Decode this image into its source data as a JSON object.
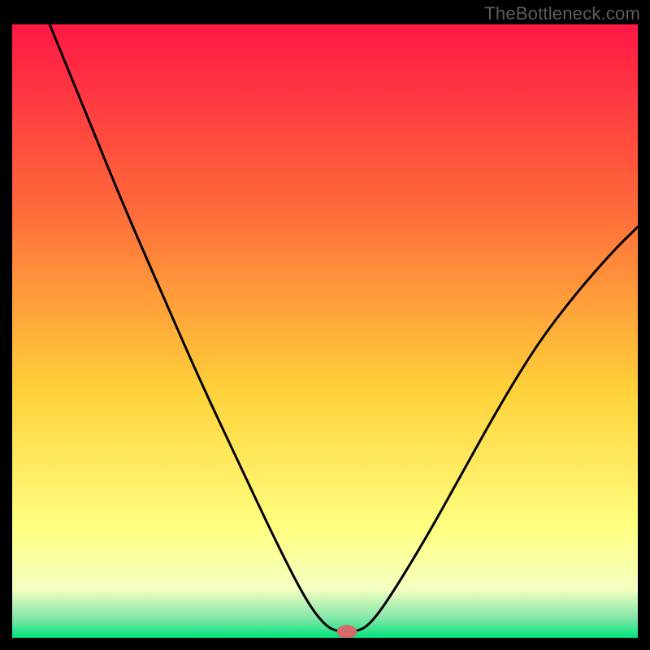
{
  "watermark": "TheBottleneck.com",
  "chart_data": {
    "type": "line",
    "title": "",
    "xlabel": "",
    "ylabel": "",
    "xlim": [
      0,
      100
    ],
    "ylim": [
      0,
      100
    ],
    "grid": false,
    "legend": false,
    "background_gradient": {
      "top_color": "#ff1845",
      "mid_top_color": "#ff6a3a",
      "mid_color": "#ffd23a",
      "mid_low_color": "#ffff80",
      "low_band_color": "#f5ffc0",
      "bottom_band_color": "#7de6a9",
      "bottom_color": "#00e47a"
    },
    "series": [
      {
        "name": "bottleneck-curve",
        "color": "#000000",
        "points": [
          {
            "x": 6,
            "y": 100
          },
          {
            "x": 12,
            "y": 85
          },
          {
            "x": 18,
            "y": 70
          },
          {
            "x": 24,
            "y": 56
          },
          {
            "x": 30,
            "y": 42
          },
          {
            "x": 36,
            "y": 29
          },
          {
            "x": 42,
            "y": 16
          },
          {
            "x": 47,
            "y": 6
          },
          {
            "x": 50,
            "y": 2
          },
          {
            "x": 52,
            "y": 1
          },
          {
            "x": 55,
            "y": 1
          },
          {
            "x": 57,
            "y": 2
          },
          {
            "x": 60,
            "y": 6
          },
          {
            "x": 66,
            "y": 16
          },
          {
            "x": 72,
            "y": 27
          },
          {
            "x": 78,
            "y": 38
          },
          {
            "x": 84,
            "y": 48
          },
          {
            "x": 90,
            "y": 56
          },
          {
            "x": 96,
            "y": 63
          },
          {
            "x": 100,
            "y": 67
          }
        ]
      }
    ],
    "marker": {
      "name": "selected-point",
      "x": 53.5,
      "y": 1,
      "color": "#d46a6a",
      "rx": 1.6,
      "ry": 1.1
    }
  }
}
